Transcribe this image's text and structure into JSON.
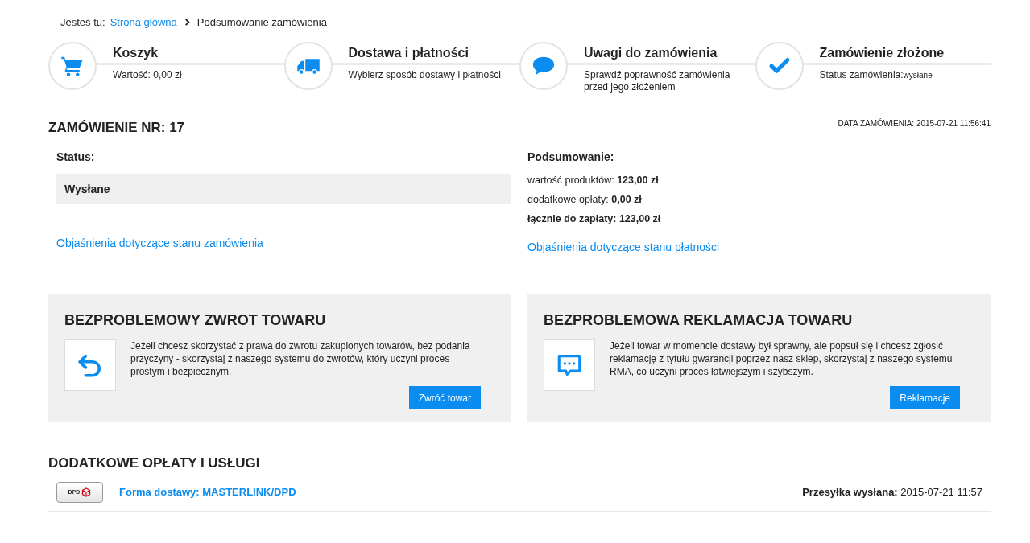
{
  "breadcrumb": {
    "label": "Jesteś tu:",
    "items": [
      {
        "text": "Strona główna",
        "kind": "link"
      },
      {
        "text": "Podsumowanie zamówienia",
        "kind": "current"
      }
    ]
  },
  "steps": [
    {
      "kind": "cart",
      "title": "Koszyk",
      "lines": [
        "Wartość: 0,00 zł"
      ]
    },
    {
      "kind": "delivery",
      "title": "Dostawa i płatności",
      "lines": [
        "Wybierz sposób dostawy i płatności"
      ]
    },
    {
      "kind": "notes",
      "title": "Uwagi do zamówienia",
      "lines": [
        "Sprawdź poprawność zamówienia",
        "przed jego złożeniem"
      ]
    },
    {
      "kind": "done",
      "title": "Zamówienie złożone",
      "lines": [
        "Status zamówienia:"
      ],
      "status_value": "wysłane"
    }
  ],
  "order": {
    "title": "ZAMÓWIENIE NR: 17",
    "date": "DATA ZAMÓWIENIA: 2015-07-21 11:56:41",
    "status": {
      "heading": "Status:",
      "value": "Wysłane",
      "link": "Objaśnienia dotyczące stanu zamówienia"
    },
    "summary": {
      "heading": "Podsumowanie:",
      "lines": [
        {
          "text": "wartość produktów: **123,00 zł**",
          "kind": "normal"
        },
        {
          "text": "dodatkowe opłaty: **0,00 zł**",
          "kind": "normal"
        },
        {
          "text": "łącznie do zapłaty: 123,00 zł",
          "kind": "total"
        }
      ],
      "link": "Objaśnienia dotyczące stanu płatności"
    }
  },
  "panels": [
    {
      "kind": "return",
      "title": "BEZPROBLEMOWY ZWROT TOWARU",
      "text": "Jeżeli chcesz skorzystać z prawa do zwrotu zakupionych towarów, bez podania przyczyny - skorzystaj z naszego systemu do zwrotów, który uczyni proces prostym i bezpiecznym.",
      "button": "Zwróć towar"
    },
    {
      "kind": "complaint",
      "title": "BEZPROBLEMOWA REKLAMACJA TOWARU",
      "text": "Jeżeli towar w momencie dostawy był sprawny, ale popsuł się i chcesz zgłosić reklamację z tytułu gwarancji poprzez nasz sklep, skorzystaj z naszego systemu RMA, co uczyni proces łatwiejszym i szybszym.",
      "button": "Reklamacje"
    }
  ],
  "extras": {
    "title": "DODATKOWE OPŁATY I USŁUGI",
    "rows": [
      {
        "logo": "DPD",
        "name": "Forma dostawy: MASTERLINK/DPD",
        "info": "**Przesyłka wysłana:** 2015-07-21 11:57"
      }
    ]
  }
}
